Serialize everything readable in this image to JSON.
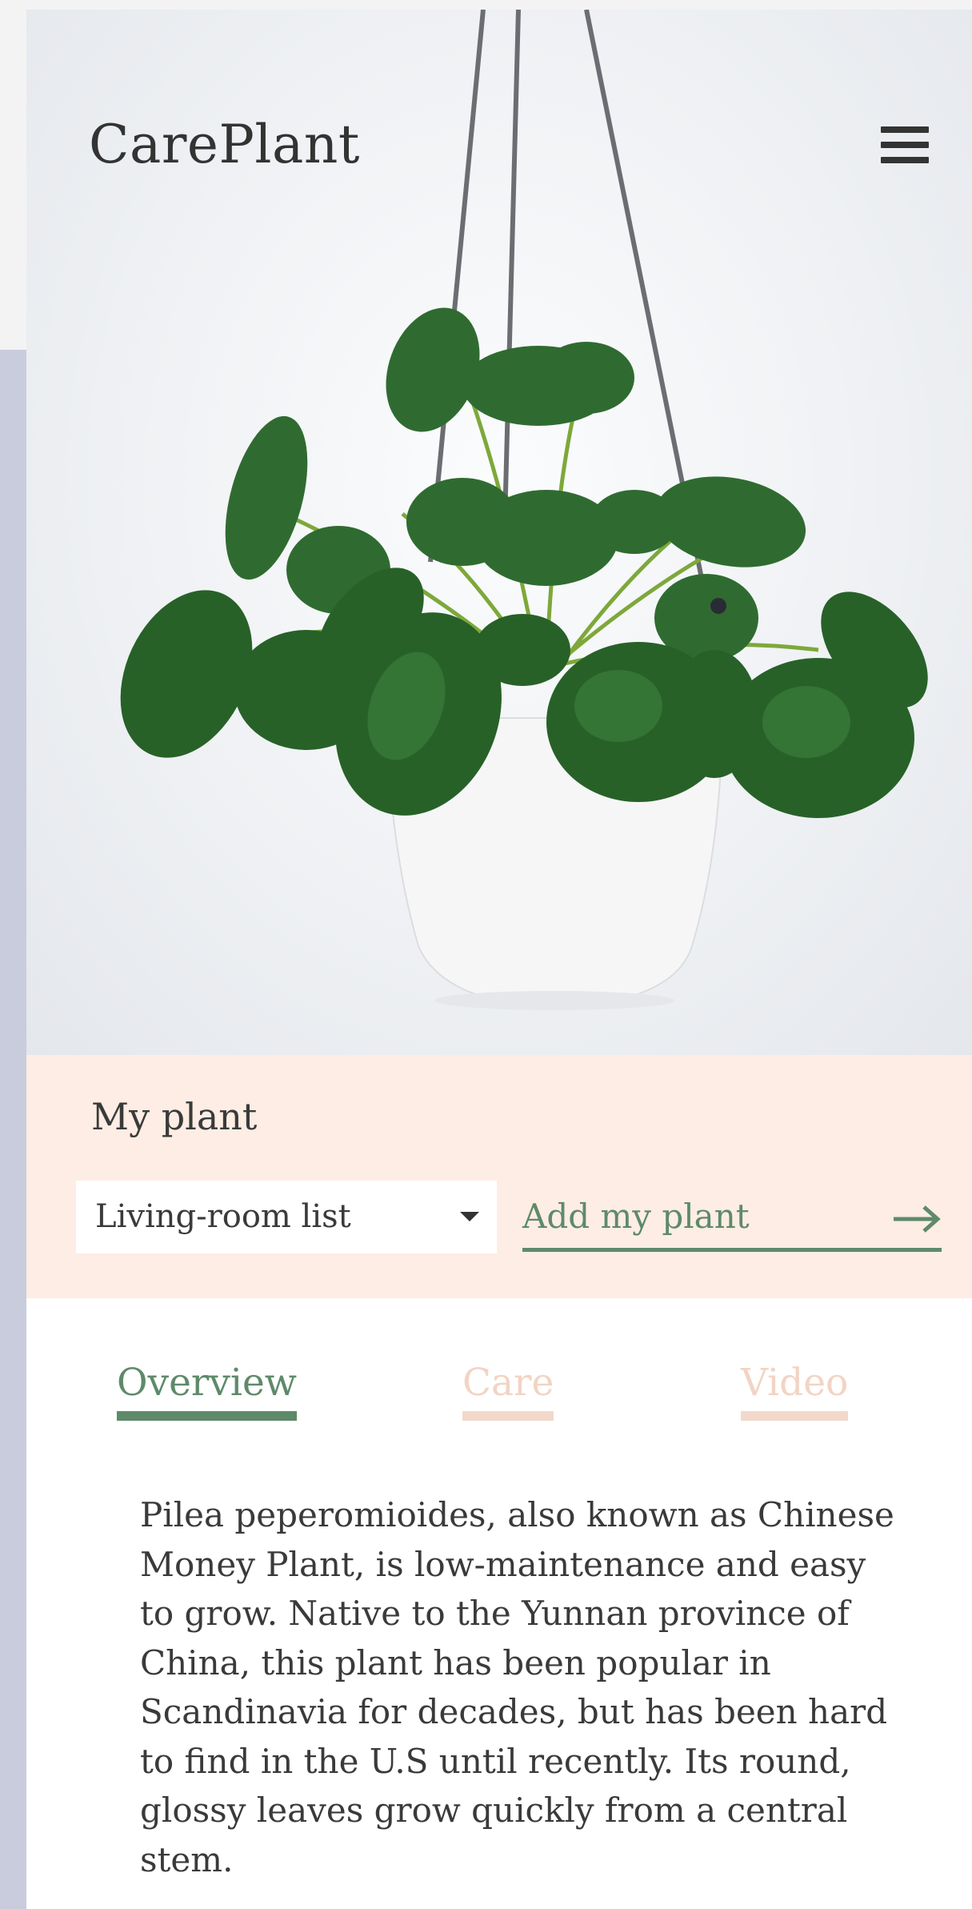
{
  "app": {
    "brand": "CarePlant"
  },
  "header": {
    "menu_icon": "hamburger-icon"
  },
  "hero": {
    "image": "hanging potted pilea plant"
  },
  "my_plant": {
    "title": "My plant",
    "list_select": {
      "value": "Living-room list"
    },
    "add_button": {
      "label": "Add my plant",
      "icon": "arrow-right-icon"
    }
  },
  "tabs": [
    {
      "label": "Overview",
      "active": true
    },
    {
      "label": "Care",
      "active": false
    },
    {
      "label": "Video",
      "active": false
    }
  ],
  "overview": {
    "text": "Pilea peperomioides, also known as Chinese Money Plant, is low-maintenance and easy to grow. Native to the Yunnan province of China, this plant has been popular in Scandinavia for decades, but has been hard to find in the U.S until recently. Its round, glossy leaves grow quickly from a central stem."
  },
  "colors": {
    "accent_green": "#5e8a6a",
    "inactive_tab": "#f2d4c4",
    "section_bg": "#fdede4",
    "page_side": "#c9ccdc"
  }
}
